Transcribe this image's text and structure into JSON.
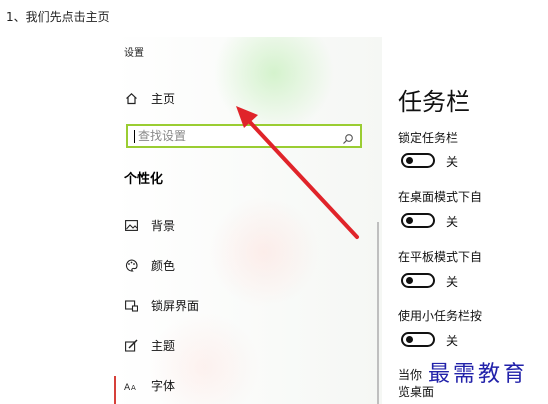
{
  "caption": "1、我们先点击主页",
  "settings": {
    "window_title": "设置",
    "home_label": "主页",
    "search_placeholder": "查找设置",
    "section_title": "个性化",
    "nav": [
      {
        "label": "背景",
        "icon": "picture-icon"
      },
      {
        "label": "颜色",
        "icon": "palette-icon"
      },
      {
        "label": "锁屏界面",
        "icon": "lock-screen-icon"
      },
      {
        "label": "主题",
        "icon": "brush-icon"
      },
      {
        "label": "字体",
        "icon": "font-icon"
      }
    ]
  },
  "taskbar": {
    "title": "任务栏",
    "options": [
      {
        "label": "锁定任务栏",
        "state": "关",
        "on": false
      },
      {
        "label": "在桌面模式下自",
        "state": "关",
        "on": false
      },
      {
        "label": "在平板模式下自",
        "state": "关",
        "on": false
      },
      {
        "label": "使用小任务栏按",
        "state": "关",
        "on": false
      }
    ],
    "partial_line1": "当你",
    "partial_line2": "览桌面"
  },
  "annotation": {
    "arrow_color": "#e0242a"
  },
  "watermark": "最需教育"
}
